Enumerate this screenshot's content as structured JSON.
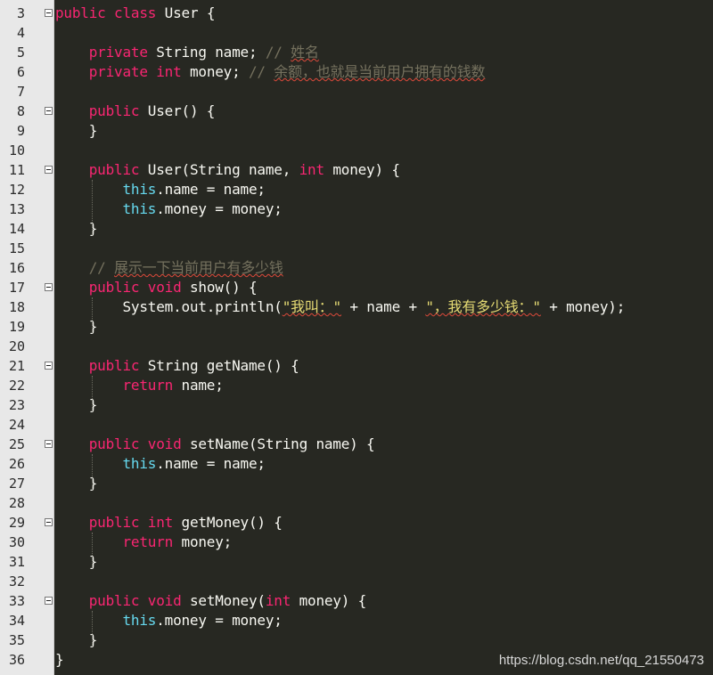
{
  "lines": [
    {
      "n": "3",
      "fold": true,
      "indent": "",
      "tokens": [
        [
          "kw",
          "public"
        ],
        [
          "p",
          " "
        ],
        [
          "kw",
          "class"
        ],
        [
          "p",
          " User {"
        ]
      ]
    },
    {
      "n": "4",
      "fold": false,
      "indent": "",
      "tokens": []
    },
    {
      "n": "5",
      "fold": false,
      "indent": "    ",
      "tokens": [
        [
          "kw",
          "private"
        ],
        [
          "p",
          " String name; "
        ],
        [
          "cm",
          "// "
        ],
        [
          "cmsq",
          "姓名"
        ]
      ]
    },
    {
      "n": "6",
      "fold": false,
      "indent": "    ",
      "tokens": [
        [
          "kw",
          "private"
        ],
        [
          "p",
          " "
        ],
        [
          "kw",
          "int"
        ],
        [
          "p",
          " money; "
        ],
        [
          "cm",
          "// "
        ],
        [
          "cmsq",
          "余额，也就是当前用户拥有的钱数"
        ]
      ]
    },
    {
      "n": "7",
      "fold": false,
      "indent": "",
      "tokens": []
    },
    {
      "n": "8",
      "fold": true,
      "indent": "    ",
      "tokens": [
        [
          "kw",
          "public"
        ],
        [
          "p",
          " User() {"
        ]
      ]
    },
    {
      "n": "9",
      "fold": false,
      "indent": "    ",
      "tokens": [
        [
          "p",
          "}"
        ]
      ]
    },
    {
      "n": "10",
      "fold": false,
      "indent": "",
      "tokens": []
    },
    {
      "n": "11",
      "fold": true,
      "indent": "    ",
      "tokens": [
        [
          "kw",
          "public"
        ],
        [
          "p",
          " User(String name, "
        ],
        [
          "kw",
          "int"
        ],
        [
          "p",
          " money) {"
        ]
      ]
    },
    {
      "n": "12",
      "fold": false,
      "indent": "        ",
      "tokens": [
        [
          "this",
          "this"
        ],
        [
          "p",
          ".name = name;"
        ]
      ]
    },
    {
      "n": "13",
      "fold": false,
      "indent": "        ",
      "tokens": [
        [
          "this",
          "this"
        ],
        [
          "p",
          ".money = money;"
        ]
      ]
    },
    {
      "n": "14",
      "fold": false,
      "indent": "    ",
      "tokens": [
        [
          "p",
          "}"
        ]
      ]
    },
    {
      "n": "15",
      "fold": false,
      "indent": "",
      "tokens": []
    },
    {
      "n": "16",
      "fold": false,
      "indent": "    ",
      "tokens": [
        [
          "cm",
          "// "
        ],
        [
          "cmsq",
          "展示一下当前用户有多少钱"
        ]
      ]
    },
    {
      "n": "17",
      "fold": true,
      "indent": "    ",
      "tokens": [
        [
          "kw",
          "public"
        ],
        [
          "p",
          " "
        ],
        [
          "kw",
          "void"
        ],
        [
          "p",
          " show() {"
        ]
      ]
    },
    {
      "n": "18",
      "fold": false,
      "indent": "        ",
      "tokens": [
        [
          "p",
          "System.out.println("
        ],
        [
          "str",
          "\"我叫：\""
        ],
        [
          "p",
          " + name + "
        ],
        [
          "str",
          "\"，我有多少钱：\""
        ],
        [
          "p",
          " + money);"
        ]
      ]
    },
    {
      "n": "19",
      "fold": false,
      "indent": "    ",
      "tokens": [
        [
          "p",
          "}"
        ]
      ]
    },
    {
      "n": "20",
      "fold": false,
      "indent": "",
      "tokens": []
    },
    {
      "n": "21",
      "fold": true,
      "indent": "    ",
      "tokens": [
        [
          "kw",
          "public"
        ],
        [
          "p",
          " String getName() {"
        ]
      ]
    },
    {
      "n": "22",
      "fold": false,
      "indent": "        ",
      "tokens": [
        [
          "kw",
          "return"
        ],
        [
          "p",
          " name;"
        ]
      ]
    },
    {
      "n": "23",
      "fold": false,
      "indent": "    ",
      "tokens": [
        [
          "p",
          "}"
        ]
      ]
    },
    {
      "n": "24",
      "fold": false,
      "indent": "",
      "tokens": []
    },
    {
      "n": "25",
      "fold": true,
      "indent": "    ",
      "tokens": [
        [
          "kw",
          "public"
        ],
        [
          "p",
          " "
        ],
        [
          "kw",
          "void"
        ],
        [
          "p",
          " setName(String name) {"
        ]
      ]
    },
    {
      "n": "26",
      "fold": false,
      "indent": "        ",
      "tokens": [
        [
          "this",
          "this"
        ],
        [
          "p",
          ".name = name;"
        ]
      ]
    },
    {
      "n": "27",
      "fold": false,
      "indent": "    ",
      "tokens": [
        [
          "p",
          "}"
        ]
      ]
    },
    {
      "n": "28",
      "fold": false,
      "indent": "",
      "tokens": []
    },
    {
      "n": "29",
      "fold": true,
      "indent": "    ",
      "tokens": [
        [
          "kw",
          "public"
        ],
        [
          "p",
          " "
        ],
        [
          "kw",
          "int"
        ],
        [
          "p",
          " getMoney() {"
        ]
      ]
    },
    {
      "n": "30",
      "fold": false,
      "indent": "        ",
      "tokens": [
        [
          "kw",
          "return"
        ],
        [
          "p",
          " money;"
        ]
      ]
    },
    {
      "n": "31",
      "fold": false,
      "indent": "    ",
      "tokens": [
        [
          "p",
          "}"
        ]
      ]
    },
    {
      "n": "32",
      "fold": false,
      "indent": "",
      "tokens": []
    },
    {
      "n": "33",
      "fold": true,
      "indent": "    ",
      "tokens": [
        [
          "kw",
          "public"
        ],
        [
          "p",
          " "
        ],
        [
          "kw",
          "void"
        ],
        [
          "p",
          " setMoney("
        ],
        [
          "kw",
          "int"
        ],
        [
          "p",
          " money) {"
        ]
      ]
    },
    {
      "n": "34",
      "fold": false,
      "indent": "        ",
      "tokens": [
        [
          "this",
          "this"
        ],
        [
          "p",
          ".money = money;"
        ]
      ]
    },
    {
      "n": "35",
      "fold": false,
      "indent": "    ",
      "tokens": [
        [
          "p",
          "}"
        ]
      ]
    },
    {
      "n": "36",
      "fold": false,
      "indent": "",
      "tokens": [
        [
          "p",
          "}"
        ]
      ]
    }
  ],
  "watermark": "https://blog.csdn.net/qq_21550473",
  "colors": {
    "background": "#272822",
    "gutter": "#e8e8e8",
    "keyword": "#f92672",
    "this": "#66d9ef",
    "string": "#e6db74",
    "comment": "#75715e",
    "text": "#f8f8f2"
  }
}
